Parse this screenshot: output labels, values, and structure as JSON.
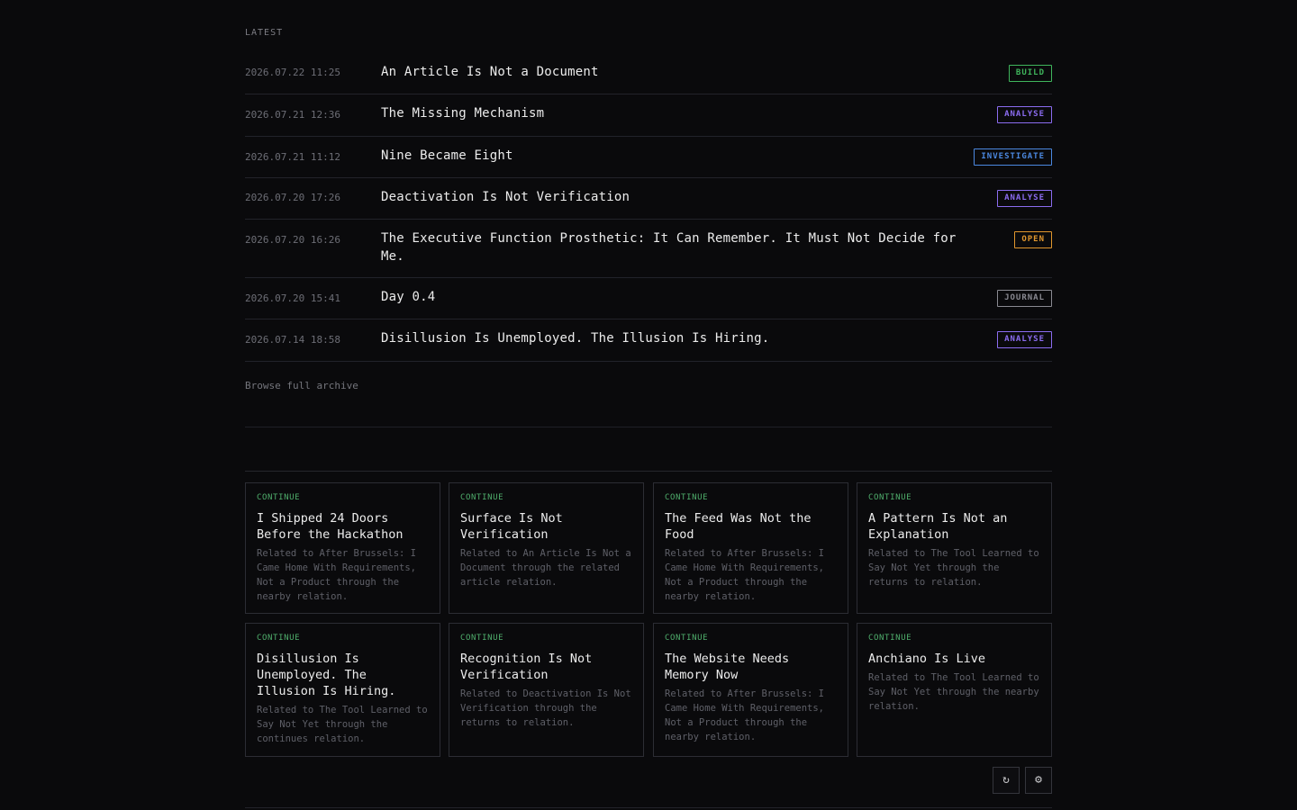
{
  "latest": {
    "label": "LATEST",
    "items": [
      {
        "date": "2026.07.22 11:25",
        "title": "An Article Is Not a Document",
        "tag": "BUILD",
        "tag_color": "#3fb55c"
      },
      {
        "date": "2026.07.21 12:36",
        "title": "The Missing Mechanism",
        "tag": "ANALYSE",
        "tag_color": "#8b6cf0"
      },
      {
        "date": "2026.07.21 11:12",
        "title": "Nine Became Eight",
        "tag": "INVESTIGATE",
        "tag_color": "#4b88e0"
      },
      {
        "date": "2026.07.20 17:26",
        "title": "Deactivation Is Not Verification",
        "tag": "ANALYSE",
        "tag_color": "#8b6cf0"
      },
      {
        "date": "2026.07.20 16:26",
        "title": "The Executive Function Prosthetic: It Can Remember. It Must Not Decide for Me.",
        "tag": "OPEN",
        "tag_color": "#e0962e"
      },
      {
        "date": "2026.07.20 15:41",
        "title": "Day 0.4",
        "tag": "JOURNAL",
        "tag_color": "#8a8a92"
      },
      {
        "date": "2026.07.14 18:58",
        "title": "Disillusion Is Unemployed. The Illusion Is Hiring.",
        "tag": "ANALYSE",
        "tag_color": "#8b6cf0"
      }
    ],
    "archive_link": "Browse full archive"
  },
  "continue_cards": [
    {
      "kicker": "CONTINUE",
      "title": "I Shipped 24 Doors Before the Hackathon",
      "desc": "Related to After Brussels: I Came Home With Requirements, Not a Product through the nearby relation."
    },
    {
      "kicker": "CONTINUE",
      "title": "Surface Is Not Verification",
      "desc": "Related to An Article Is Not a Document through the related article relation."
    },
    {
      "kicker": "CONTINUE",
      "title": "The Feed Was Not the Food",
      "desc": "Related to After Brussels: I Came Home With Requirements, Not a Product through the nearby relation."
    },
    {
      "kicker": "CONTINUE",
      "title": "A Pattern Is Not an Explanation",
      "desc": "Related to The Tool Learned to Say Not Yet through the returns to relation."
    },
    {
      "kicker": "CONTINUE",
      "title": "Disillusion Is Unemployed. The Illusion Is Hiring.",
      "desc": "Related to The Tool Learned to Say Not Yet through the continues relation."
    },
    {
      "kicker": "CONTINUE",
      "title": "Recognition Is Not Verification",
      "desc": "Related to Deactivation Is Not Verification through the returns to relation."
    },
    {
      "kicker": "CONTINUE",
      "title": "The Website Needs Memory Now",
      "desc": "Related to After Brussels: I Came Home With Requirements, Not a Product through the nearby relation."
    },
    {
      "kicker": "CONTINUE",
      "title": "Anchiano Is Live",
      "desc": "Related to The Tool Learned to Say Not Yet through the nearby relation."
    }
  ],
  "controls": {
    "refresh_icon": "↻",
    "settings_icon": "⚙"
  },
  "colors": {
    "background": "#0a0a0c",
    "kicker": "#4fae6c"
  }
}
